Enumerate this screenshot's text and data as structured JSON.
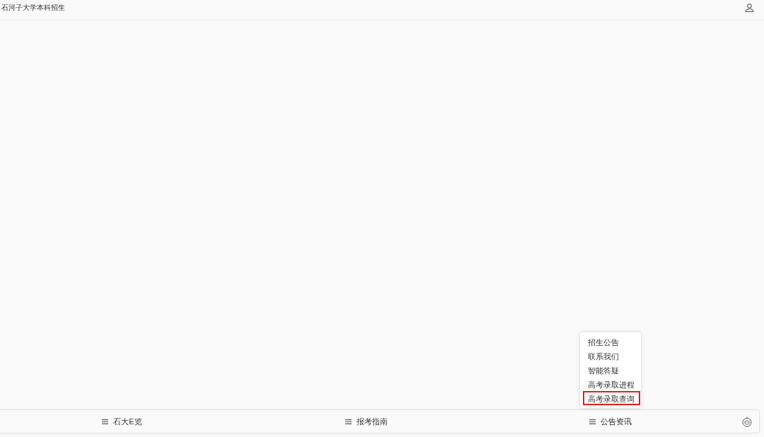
{
  "header": {
    "title": "石河子大学本科招生"
  },
  "menu_bar": {
    "items": [
      {
        "label": "石大E览",
        "expanded": false
      },
      {
        "label": "报考指南",
        "expanded": false
      },
      {
        "label": "公告资讯",
        "expanded": true,
        "submenu": [
          {
            "label": "招生公告",
            "highlighted": false
          },
          {
            "label": "联系我们",
            "highlighted": false
          },
          {
            "label": "智能答疑",
            "highlighted": false
          },
          {
            "label": "高考录取进程",
            "highlighted": false
          },
          {
            "label": "高考录取查询",
            "highlighted": true
          }
        ]
      }
    ]
  }
}
